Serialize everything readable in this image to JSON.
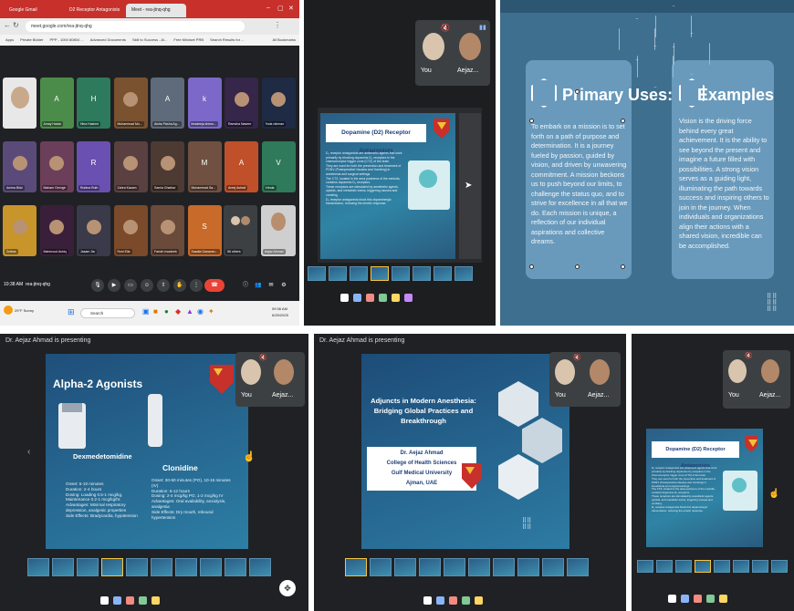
{
  "panel1": {
    "tabs": [
      "Google Gmail",
      "D2 Receptor Antagonists & Al x",
      "Meet - rea-jtnq-qhg"
    ],
    "url": "meet.google.com/rea-jtnq-qhg",
    "bookmarks": [
      "Apps",
      "Private Bidder",
      "PPP - 1000 80804 ...",
      "Advanced Documents",
      "Skill to Success - Al...",
      "Free Mindset PRB",
      "Search Results for ...",
      "All Bookmarks"
    ],
    "tiles": [
      {
        "initial": "A",
        "name": "Amay Hadar",
        "color": "#4c8c4a"
      },
      {
        "initial": "H",
        "name": "Hina Hashmi",
        "color": "#2d7a5c"
      },
      {
        "initial": "",
        "name": "Muhammad Mu...",
        "color": "#7a5230"
      },
      {
        "initial": "A",
        "name": "Aisha Pasha Ag...",
        "color": "#5f6b7a"
      },
      {
        "initial": "k",
        "name": "khadeeja shimu...",
        "color": "#7b68c9"
      },
      {
        "initial": "",
        "name": "Ramsha Naseer",
        "color": "#35264a"
      },
      {
        "initial": "",
        "name": "Yoda rahman",
        "color": "#1f2a44"
      },
      {
        "initial": "",
        "name": "Amina Bilal",
        "color": "#5a4a7a"
      },
      {
        "initial": "",
        "name": "Maham George",
        "color": "#6b3f5a"
      },
      {
        "initial": "R",
        "name": "Rubina Ruth",
        "color": "#6a50b0"
      },
      {
        "initial": "",
        "name": "Zahra Kazam",
        "color": "#5a4040"
      },
      {
        "initial": "",
        "name": "Samia Ghafoor",
        "color": "#4d3a32"
      },
      {
        "initial": "M",
        "name": "Muhammad Sa...",
        "color": "#705040"
      },
      {
        "initial": "A",
        "name": "Areej Ashraf",
        "color": "#c0502a"
      },
      {
        "initial": "V",
        "name": "Vrinda",
        "color": "#2e7a5a"
      },
      {
        "initial": "",
        "name": "Zulima",
        "color": "#c8952a"
      },
      {
        "initial": "",
        "name": "Mahmood Ashiq",
        "color": "#3a1f3a"
      },
      {
        "initial": "",
        "name": "Jasam Jia",
        "color": "#3a3a4a"
      },
      {
        "initial": "",
        "name": "Rohi Ella",
        "color": "#7a4a2a"
      },
      {
        "initial": "",
        "name": "Farrah Irsadeek",
        "color": "#6a4a3a"
      },
      {
        "initial": "S",
        "name": "Saadia Ganavan...",
        "color": "#c86a2a"
      }
    ],
    "others_label": "56 others",
    "speaker_name": "Aejaz Ahmad",
    "meeting_time": "10:38 AM",
    "meeting_code": "rea-jtnq-qhg",
    "taskbar_search": "Search",
    "weather": "29°F Sunny",
    "clock_time": "09:36 AM",
    "clock_date": "6/25/2025"
  },
  "panel2": {
    "self_label": "You",
    "speaker_label": "Aejaz...",
    "slide_title": "Dopamine (D2) Receptor Antagonists",
    "bullets": [
      "D₂ receptor antagonists are antiemetic agents that work primarily by blocking dopamine D₂ receptors in the chemoreceptor trigger zone (CTZ) of the brain.",
      "They are used for both the prevention and treatment of PONV (Postoperative Nausea and Vomiting) in anesthesia and surgical settings.",
      "The CTZ, located in the area postrema of the medulla, contains dopamine D₂ receptors.",
      "These receptors are stimulated by anesthetic agents, opioids, and metabolic toxins, triggering nausea and vomiting.",
      "D₂ receptor antagonists block this dopaminergic transmission, reducing the emetic response."
    ]
  },
  "panel3": {
    "left_title": "Primary Uses:",
    "left_text": "To embark on a mission is to set forth on a path of purpose and determination. It is a journey fueled by passion, guided by vision, and driven by unwavering commitment. A mission beckons us to push beyond our limits, to challenge the status quo, and to strive for excellence in all that we do. Each mission is unique, a reflection of our individual aspirations and collective dreams.",
    "right_title": "Examples",
    "right_text": "Vision is the driving force behind every great achievement. It is the ability to see beyond the present and imagine a future filled with possibilities. A strong vision serves as a guiding light, illuminating the path towards success and inspiring others to join in the journey. When individuals and organizations align their actions with a shared vision, incredible can be accomplished."
  },
  "panel4": {
    "presenting": "Dr. Aejaz Ahmad is presenting",
    "self_label": "You",
    "speaker_label": "Aejaz...",
    "slide_title": "Alpha-2 Agonists",
    "drug1_name": "Dexmedetomidine",
    "drug1_bullets": [
      "Onset: 5-10 minutes",
      "Duration: 2-4 hours",
      "Dosing: Loading 0.5-1 mcg/kg, Maintenance 0.2-1 mcg/kg/hr.",
      "Advantages: Minimal respiratory depression, analgesic properties",
      "Side Effects: Bradycardia, hypotension"
    ],
    "drug2_name": "Clonidine",
    "drug2_bullets": [
      "Onset: 30-60 minutes (PO), 10-15 minutes (IV)",
      "Duration: 6-12 hours",
      "Dosing: 2-4 mcg/kg PO, 1-2 mcg/kg IV",
      "Advantages: Oral availability, anxiolysis, analgesia",
      "Side Effects: Dry mouth, rebound hypertension"
    ]
  },
  "panel5": {
    "presenting": "Dr. Aejaz Ahmad is presenting",
    "self_label": "You",
    "speaker_label": "Aejaz...",
    "title_lines": [
      "Adjuncts in Modern Anesthesia:",
      "Bridging Global Practices and",
      "Breakthrough"
    ],
    "author_lines": [
      "Dr. Aejaz Ahmad",
      "College of Health Sciences",
      "Gulf Medical University",
      "Ajman, UAE"
    ]
  },
  "panel6": {
    "self_label": "You",
    "speaker_label": "Aejaz...",
    "slide_title": "Dopamine (D2) Receptor Antagonists"
  }
}
